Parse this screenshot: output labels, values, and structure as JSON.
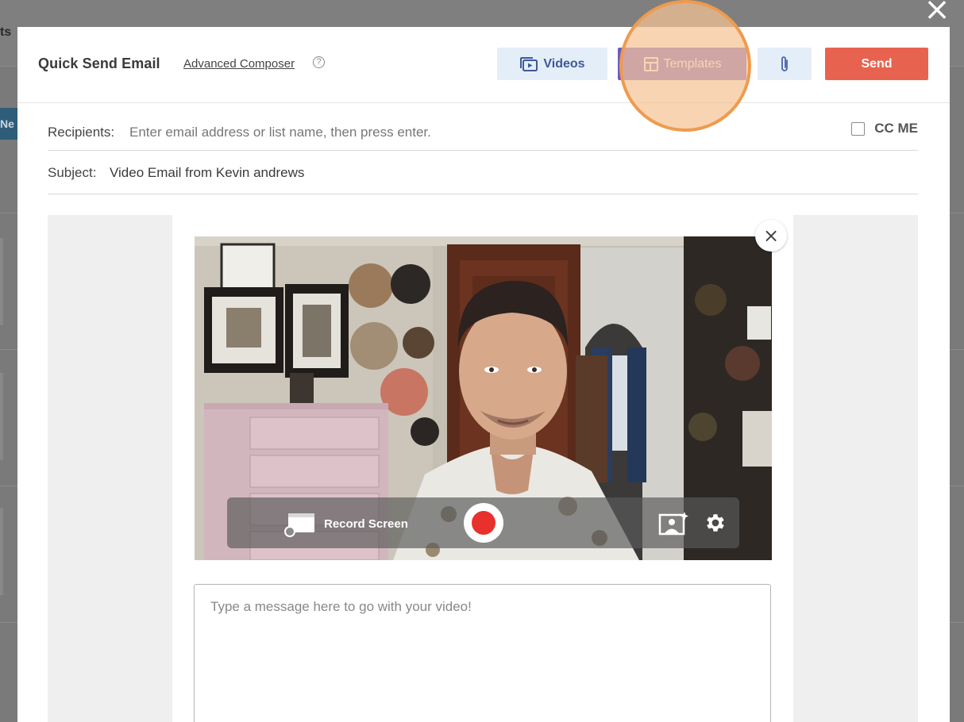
{
  "background": {
    "tab_text": "ts",
    "new_button_label": "Ne"
  },
  "modal": {
    "title": "Quick Send Email",
    "advanced_link": "Advanced Composer",
    "help_icon": "?",
    "buttons": {
      "videos_label": "Videos",
      "templates_label": "Templates",
      "send_label": "Send"
    },
    "recipients": {
      "label": "Recipients:",
      "placeholder": "Enter email address or list name, then press enter."
    },
    "cc_me_label": "CC ME",
    "subject": {
      "label": "Subject:",
      "value": "Video Email from Kevin andrews"
    },
    "video_controls": {
      "record_screen_label": "Record Screen"
    },
    "message": {
      "placeholder": "Type a message here to go with your video!"
    }
  },
  "colors": {
    "templates_button": "#6a5cc4",
    "send_button": "#e8634f",
    "videos_button_bg": "#e4eef9",
    "record_dot": "#e8312c",
    "highlight": "#ee9b4e"
  },
  "icons": {
    "close": "close-icon",
    "videos": "video-library-icon",
    "templates": "template-layout-icon",
    "attach": "paperclip-icon",
    "record_screen": "screen-record-icon",
    "background_effects": "background-effects-icon",
    "settings": "gear-icon"
  }
}
